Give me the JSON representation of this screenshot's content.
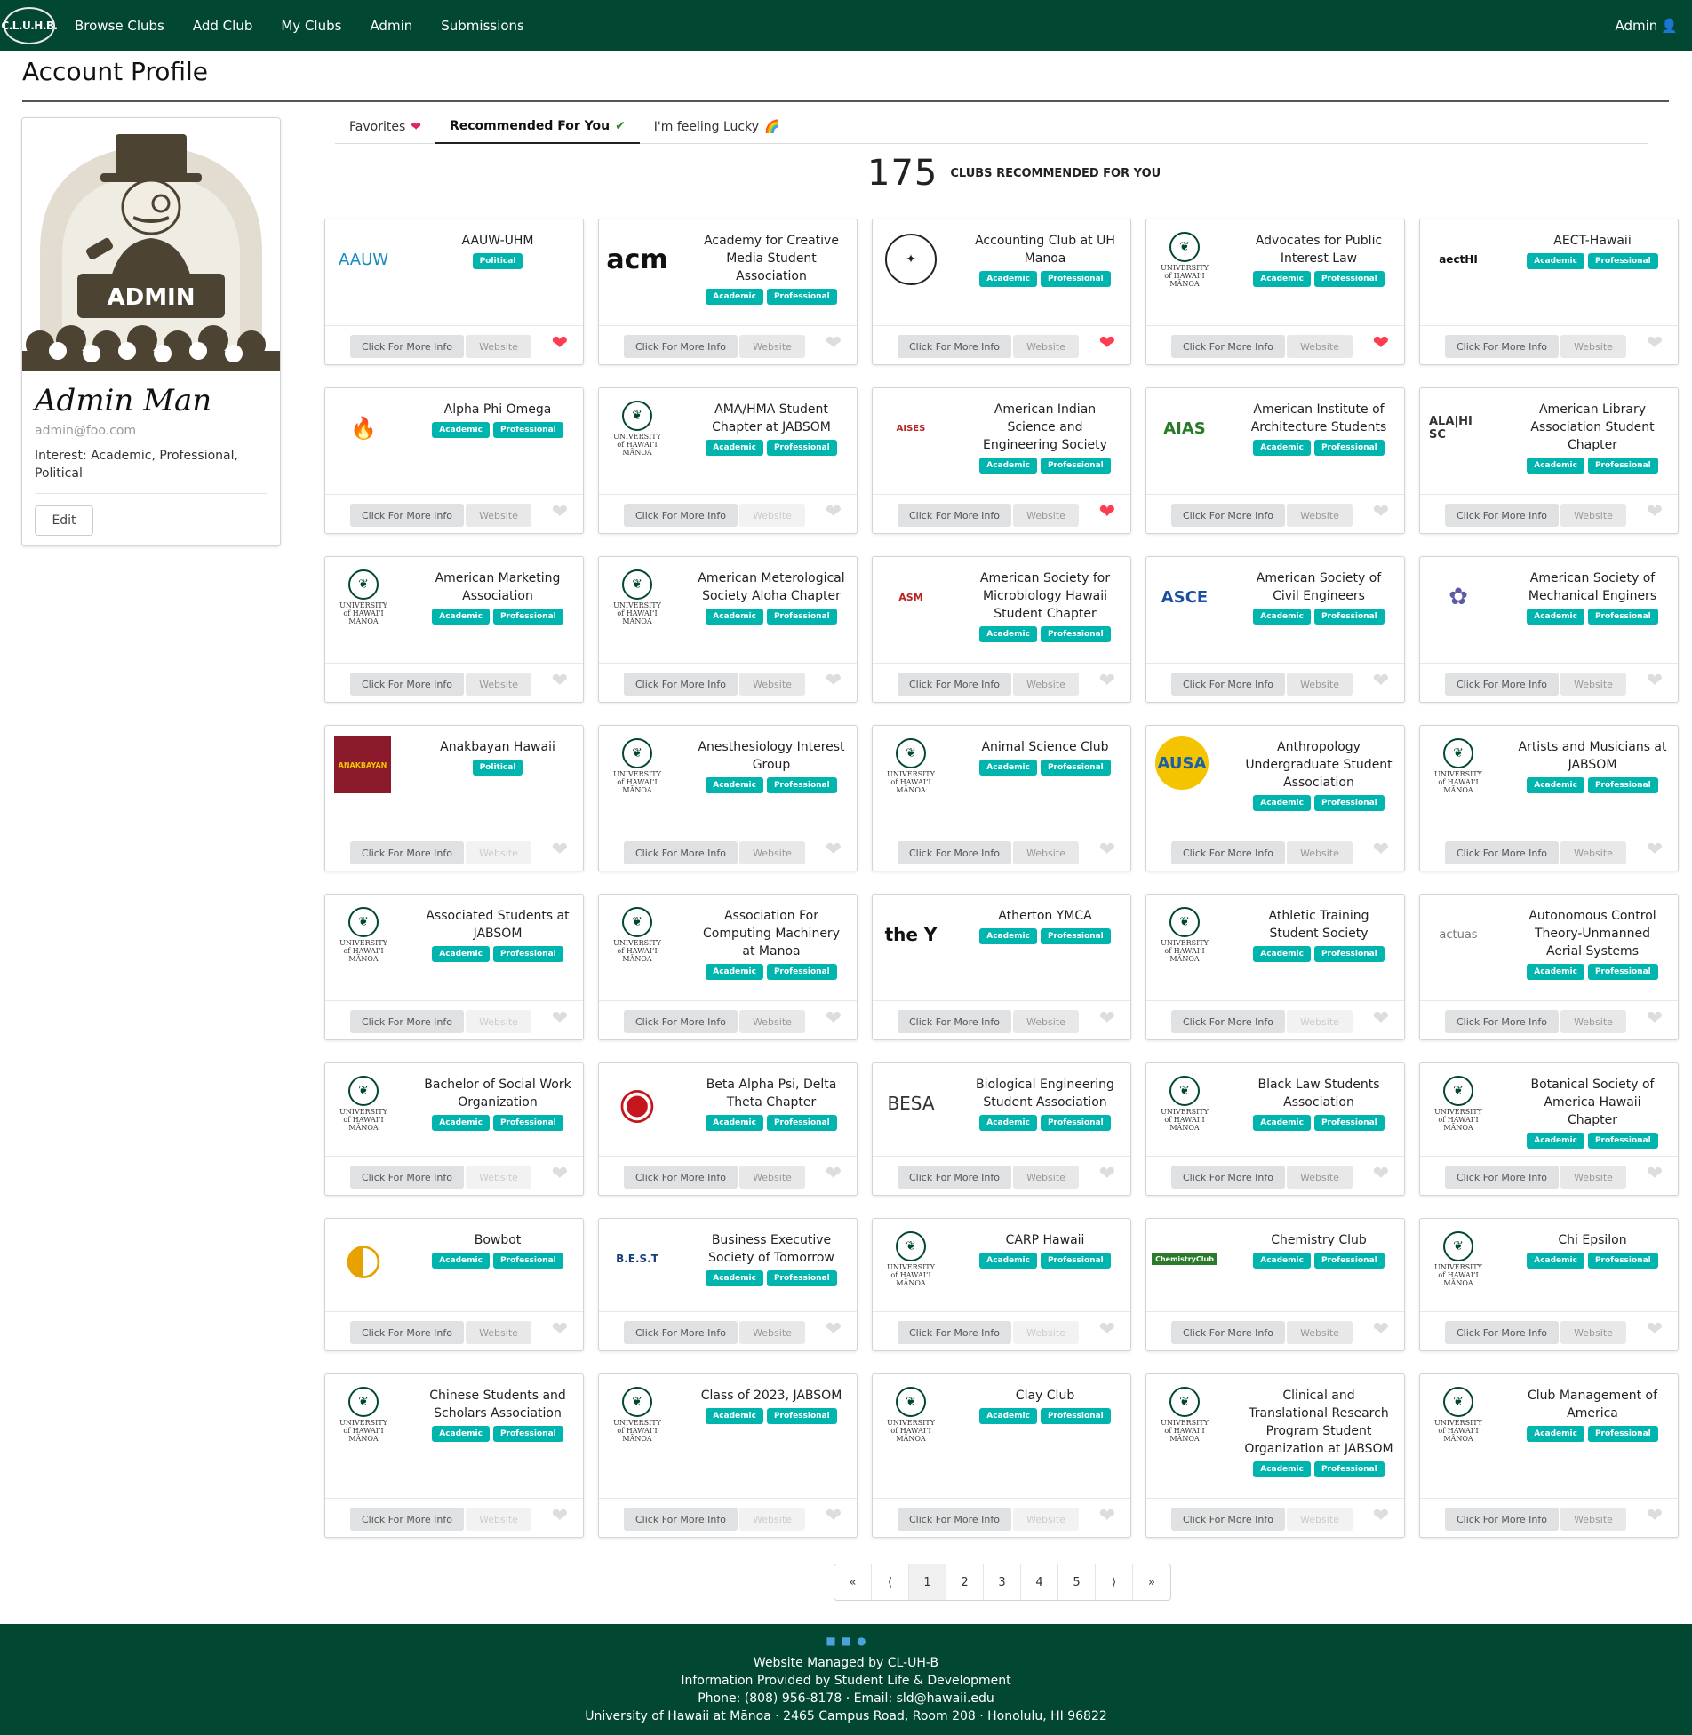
{
  "nav": {
    "logo": "C.L.U.H.B.",
    "items": [
      "Browse Clubs",
      "Add Club",
      "My Clubs",
      "Admin",
      "Submissions"
    ],
    "user": "Admin"
  },
  "page": {
    "title": "Account Profile"
  },
  "profile": {
    "image_text": "ADMIN",
    "name": "Admin Man",
    "email": "admin@foo.com",
    "interest": "Interest: Academic, Professional, Political",
    "edit": "Edit"
  },
  "tabs": [
    {
      "label": "Favorites",
      "icon": "heart-icon"
    },
    {
      "label": "Recommended For You",
      "icon": "check-icon"
    },
    {
      "label": "I'm feeling Lucky",
      "icon": "rainbow-icon"
    }
  ],
  "count": {
    "number": "175",
    "label": "Clubs Recommended for you"
  },
  "card_buttons": {
    "info": "Click For More Info",
    "website": "Website"
  },
  "clubs": [
    {
      "name": "AAUW-UHM",
      "tags": [
        "Political"
      ],
      "logo": "AAUW",
      "fav": true,
      "web": true
    },
    {
      "name": "Academy for Creative Media Student Association",
      "tags": [
        "Academic",
        "Professional"
      ],
      "logo": "acm",
      "fav": false,
      "web": true
    },
    {
      "name": "Accounting Club at UH Manoa",
      "tags": [
        "Academic",
        "Professional"
      ],
      "logo": "seal-acct",
      "fav": true,
      "web": true
    },
    {
      "name": "Advocates for Public Interest Law",
      "tags": [
        "Academic",
        "Professional"
      ],
      "logo": "uh",
      "fav": true,
      "web": true
    },
    {
      "name": "AECT-Hawaii",
      "tags": [
        "Academic",
        "Professional"
      ],
      "logo": "aectHI",
      "fav": false,
      "web": true
    },
    {
      "name": "Alpha Phi Omega",
      "tags": [
        "Academic",
        "Professional"
      ],
      "logo": "torch",
      "fav": false,
      "web": true
    },
    {
      "name": "AMA/HMA Student Chapter at JABSOM",
      "tags": [
        "Academic",
        "Professional"
      ],
      "logo": "uh",
      "fav": false,
      "web": false
    },
    {
      "name": "American Indian Science and Engineering Society",
      "tags": [
        "Academic",
        "Professional"
      ],
      "logo": "AISES",
      "fav": true,
      "web": true
    },
    {
      "name": "American Institute of Architecture Students",
      "tags": [
        "Academic",
        "Professional"
      ],
      "logo": "AIAS",
      "fav": false,
      "web": true
    },
    {
      "name": "American Library Association Student Chapter",
      "tags": [
        "Academic",
        "Professional"
      ],
      "logo": "ALA",
      "fav": false,
      "web": true
    },
    {
      "name": "American Marketing Association",
      "tags": [
        "Academic",
        "Professional"
      ],
      "logo": "uh",
      "fav": false,
      "web": true
    },
    {
      "name": "American Meterological Society Aloha Chapter",
      "tags": [
        "Academic",
        "Professional"
      ],
      "logo": "uh",
      "fav": false,
      "web": true
    },
    {
      "name": "American Society for Microbiology Hawaii Student Chapter",
      "tags": [
        "Academic",
        "Professional"
      ],
      "logo": "ASM",
      "fav": false,
      "web": true
    },
    {
      "name": "American Society of Civil Engineers",
      "tags": [
        "Academic",
        "Professional"
      ],
      "logo": "ASCE",
      "fav": false,
      "web": true
    },
    {
      "name": "American Society of Mechanical Enginers",
      "tags": [
        "Academic",
        "Professional"
      ],
      "logo": "ASME",
      "fav": false,
      "web": true
    },
    {
      "name": "Anakbayan Hawaii",
      "tags": [
        "Political"
      ],
      "logo": "ANAKBAYAN",
      "fav": false,
      "web": false
    },
    {
      "name": "Anesthesiology Interest Group",
      "tags": [
        "Academic",
        "Professional"
      ],
      "logo": "uh",
      "fav": false,
      "web": true
    },
    {
      "name": "Animal Science Club",
      "tags": [
        "Academic",
        "Professional"
      ],
      "logo": "uh",
      "fav": false,
      "web": true
    },
    {
      "name": "Anthropology Undergraduate Student Association",
      "tags": [
        "Academic",
        "Professional"
      ],
      "logo": "AUSA",
      "fav": false,
      "web": true
    },
    {
      "name": "Artists and Musicians at JABSOM",
      "tags": [
        "Academic",
        "Professional"
      ],
      "logo": "uh",
      "fav": false,
      "web": true
    },
    {
      "name": "Associated Students at JABSOM",
      "tags": [
        "Academic",
        "Professional"
      ],
      "logo": "uh",
      "fav": false,
      "web": false
    },
    {
      "name": "Association For Computing Machinery at Manoa",
      "tags": [
        "Academic",
        "Professional"
      ],
      "logo": "uh",
      "fav": false,
      "web": true
    },
    {
      "name": "Atherton YMCA",
      "tags": [
        "Academic",
        "Professional"
      ],
      "logo": "theY",
      "fav": false,
      "web": true
    },
    {
      "name": "Athletic Training Student Society",
      "tags": [
        "Academic",
        "Professional"
      ],
      "logo": "uh",
      "fav": false,
      "web": false
    },
    {
      "name": "Autonomous Control Theory-Unmanned Aerial Systems",
      "tags": [
        "Academic",
        "Professional"
      ],
      "logo": "actuas",
      "fav": false,
      "web": true
    },
    {
      "name": "Bachelor of Social Work Organization",
      "tags": [
        "Academic",
        "Professional"
      ],
      "logo": "uh",
      "fav": false,
      "web": false
    },
    {
      "name": "Beta Alpha Psi, Delta Theta Chapter",
      "tags": [
        "Academic",
        "Professional"
      ],
      "logo": "BAP",
      "fav": false,
      "web": true
    },
    {
      "name": "Biological Engineering Student Association",
      "tags": [
        "Academic",
        "Professional"
      ],
      "logo": "BESA",
      "fav": false,
      "web": true
    },
    {
      "name": "Black Law Students Association",
      "tags": [
        "Academic",
        "Professional"
      ],
      "logo": "uh",
      "fav": false,
      "web": true
    },
    {
      "name": "Botanical Society of America Hawaii Chapter",
      "tags": [
        "Academic",
        "Professional"
      ],
      "logo": "uh",
      "fav": false,
      "web": true
    },
    {
      "name": "Bowbot",
      "tags": [
        "Academic",
        "Professional"
      ],
      "logo": "bowbot",
      "fav": false,
      "web": true
    },
    {
      "name": "Business Executive Society of Tomorrow",
      "tags": [
        "Academic",
        "Professional"
      ],
      "logo": "BEST",
      "fav": false,
      "web": true
    },
    {
      "name": "CARP Hawaii",
      "tags": [
        "Academic",
        "Professional"
      ],
      "logo": "uh",
      "fav": false,
      "web": false
    },
    {
      "name": "Chemistry Club",
      "tags": [
        "Academic",
        "Professional"
      ],
      "logo": "ChemistryClub",
      "fav": false,
      "web": true
    },
    {
      "name": "Chi Epsilon",
      "tags": [
        "Academic",
        "Professional"
      ],
      "logo": "uh",
      "fav": false,
      "web": true
    },
    {
      "name": "Chinese Students and Scholars Association",
      "tags": [
        "Academic",
        "Professional"
      ],
      "logo": "uh",
      "fav": false,
      "web": false
    },
    {
      "name": "Class of 2023, JABSOM",
      "tags": [
        "Academic",
        "Professional"
      ],
      "logo": "uh",
      "fav": false,
      "web": false
    },
    {
      "name": "Clay Club",
      "tags": [
        "Academic",
        "Professional"
      ],
      "logo": "uh",
      "fav": false,
      "web": false
    },
    {
      "name": "Clinical and Translational Research Program Student Organization at JABSOM",
      "tags": [
        "Academic",
        "Professional"
      ],
      "logo": "uh",
      "fav": false,
      "web": false
    },
    {
      "name": "Club Management of America",
      "tags": [
        "Academic",
        "Professional"
      ],
      "logo": "uh",
      "fav": false,
      "web": true
    }
  ],
  "pagination": [
    "«",
    "⟨",
    "1",
    "2",
    "3",
    "4",
    "5",
    "⟩",
    "»"
  ],
  "footer": {
    "lines": [
      "Website Managed by CL-UH-B",
      "Information Provided by Student Life & Development",
      "Phone: (808) 956-8178 · Email: sld@hawaii.edu",
      "University of Hawaii at Mānoa · 2465 Campus Road, Room 208 · Honolulu, HI 96822"
    ]
  },
  "colors": {
    "nav": "#024731",
    "badge": "#00b5ad",
    "heart_on": "#ff3c50"
  }
}
